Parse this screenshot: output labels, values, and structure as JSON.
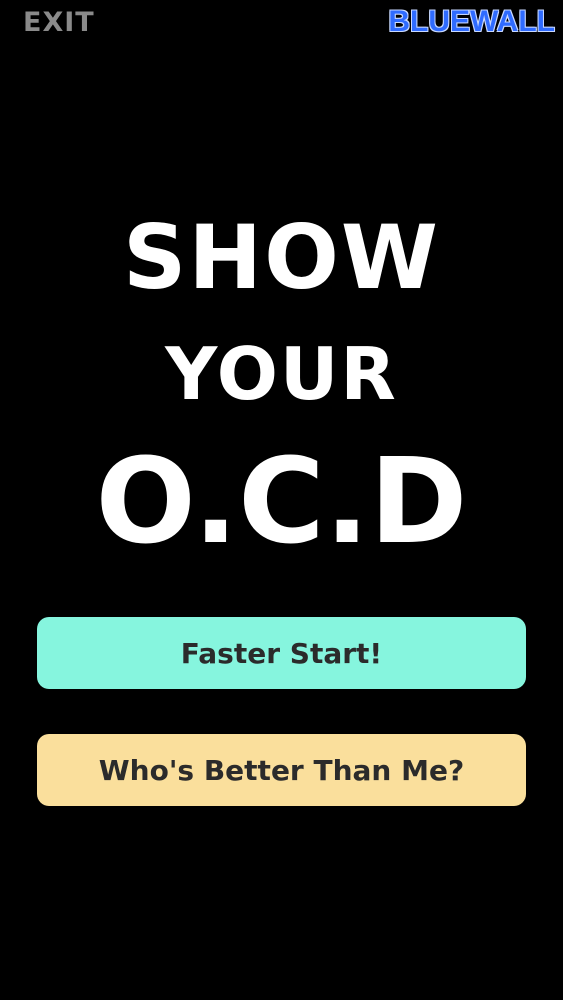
{
  "header": {
    "exit_label": "EXIT",
    "brand_label": "BLUEWALL"
  },
  "title": {
    "line1": "SHOW",
    "line2": "YOUR",
    "line3": "O.C.D"
  },
  "buttons": {
    "faster_start": "Faster Start!",
    "whos_better": "Who's Better Than Me?"
  },
  "colors": {
    "background": "#000000",
    "faster_start_bg": "#86f5de",
    "whos_better_bg": "#fadf9c",
    "brand": "#2f6bff"
  }
}
